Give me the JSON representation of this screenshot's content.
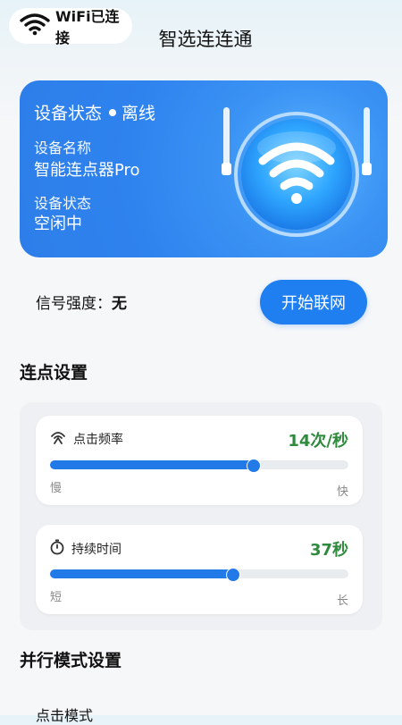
{
  "status_bar": {
    "wifi_text": "WiFi已连接"
  },
  "app": {
    "title": "智选连连通"
  },
  "device": {
    "status_heading": "设备状态",
    "status_value": "离线",
    "name_label": "设备名称",
    "name_value": "智能连点器Pro",
    "state_label": "设备状态",
    "state_value": "空闲中"
  },
  "signal": {
    "label": "信号强度：",
    "value": "无"
  },
  "start_button": {
    "label": "开始联网"
  },
  "click_settings": {
    "title": "连点设置",
    "frequency": {
      "label": "点击频率",
      "value": "14次/秒",
      "min_label": "慢",
      "max_label": "快",
      "level": 0.68
    },
    "duration": {
      "label": "持续时间",
      "value": "37秒",
      "min_label": "短",
      "max_label": "长",
      "level": 0.61
    }
  },
  "parallel": {
    "title": "并行模式设置",
    "next_label": "点击模式"
  },
  "colors": {
    "accent": "#1f7ef0",
    "value_green": "#2e8a3c",
    "card_blue": "#2f83ee"
  }
}
